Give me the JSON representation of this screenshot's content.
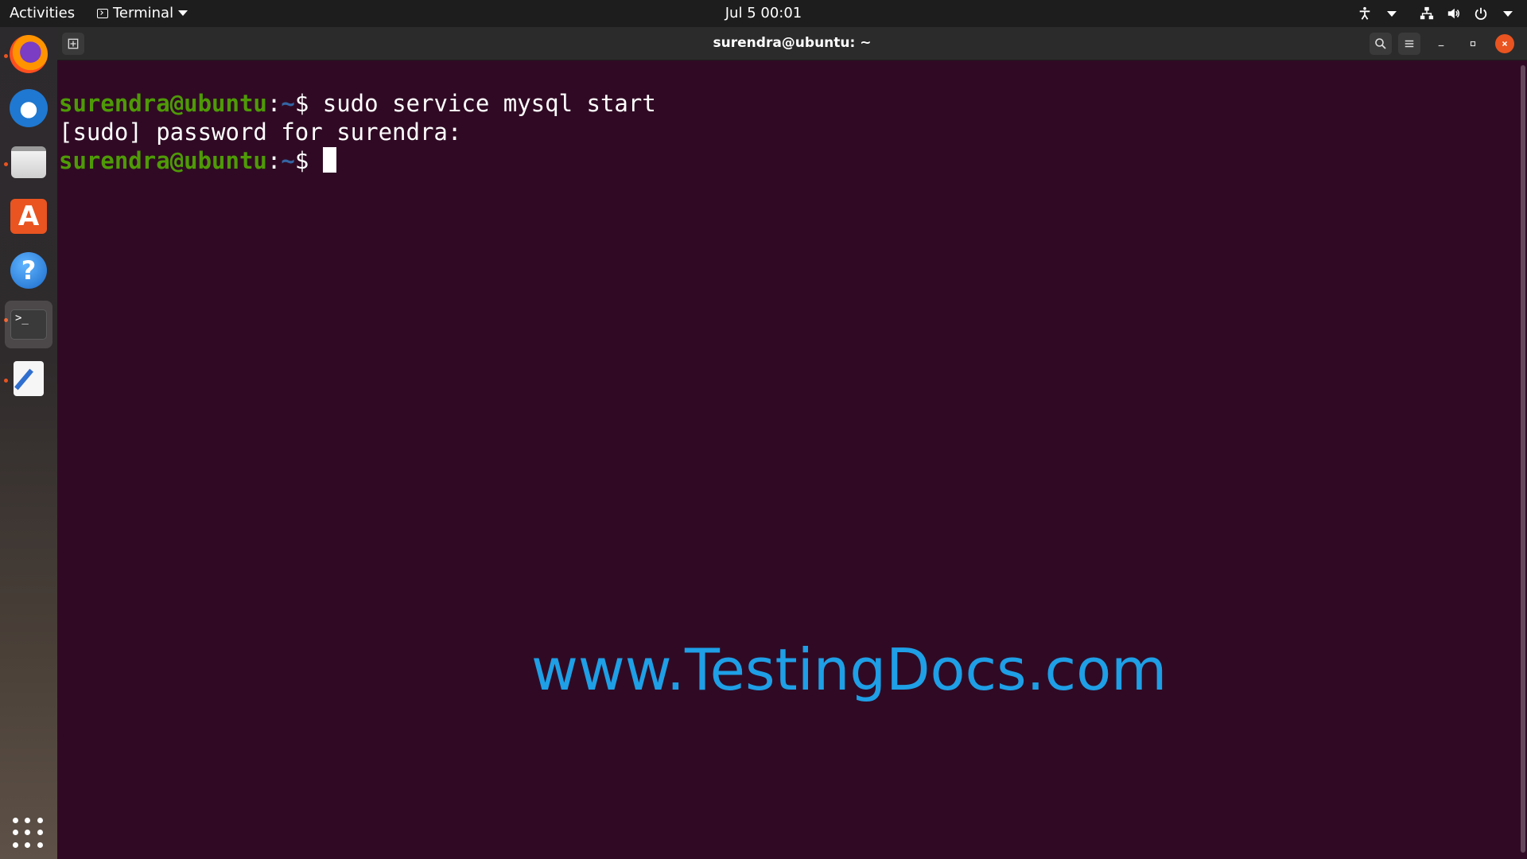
{
  "topbar": {
    "activities": "Activities",
    "app_menu": "Terminal",
    "clock": "Jul 5  00:01"
  },
  "dock": {
    "apps": [
      {
        "name": "Firefox Web Browser",
        "icon": "firefox-icon",
        "running": true
      },
      {
        "name": "Thunderbird Mail",
        "icon": "thunderbird-icon",
        "running": false
      },
      {
        "name": "Files",
        "icon": "files-icon",
        "running": true
      },
      {
        "name": "Ubuntu Software",
        "icon": "software-icon",
        "running": false
      },
      {
        "name": "Help",
        "icon": "help-icon",
        "running": false
      },
      {
        "name": "Terminal",
        "icon": "terminal-icon",
        "running": true,
        "active": true
      },
      {
        "name": "Text Editor",
        "icon": "text-editor-icon",
        "running": true
      }
    ],
    "software_glyph": "A",
    "help_glyph": "?",
    "terminal_glyph": ">_"
  },
  "window": {
    "title": "surendra@ubuntu: ~"
  },
  "terminal": {
    "prompt_user": "surendra@ubuntu",
    "prompt_sep": ":",
    "prompt_path": "~",
    "prompt_symbol": "$ ",
    "line1_cmd": "sudo service mysql start",
    "line2_text": "[sudo] password for surendra:"
  },
  "watermark": "www.TestingDocs.com",
  "colors": {
    "terminal_bg": "#300a24",
    "prompt_user": "#4e9a06",
    "prompt_path": "#3465a4",
    "watermark": "#1e9fe6",
    "accent": "#e95420"
  }
}
